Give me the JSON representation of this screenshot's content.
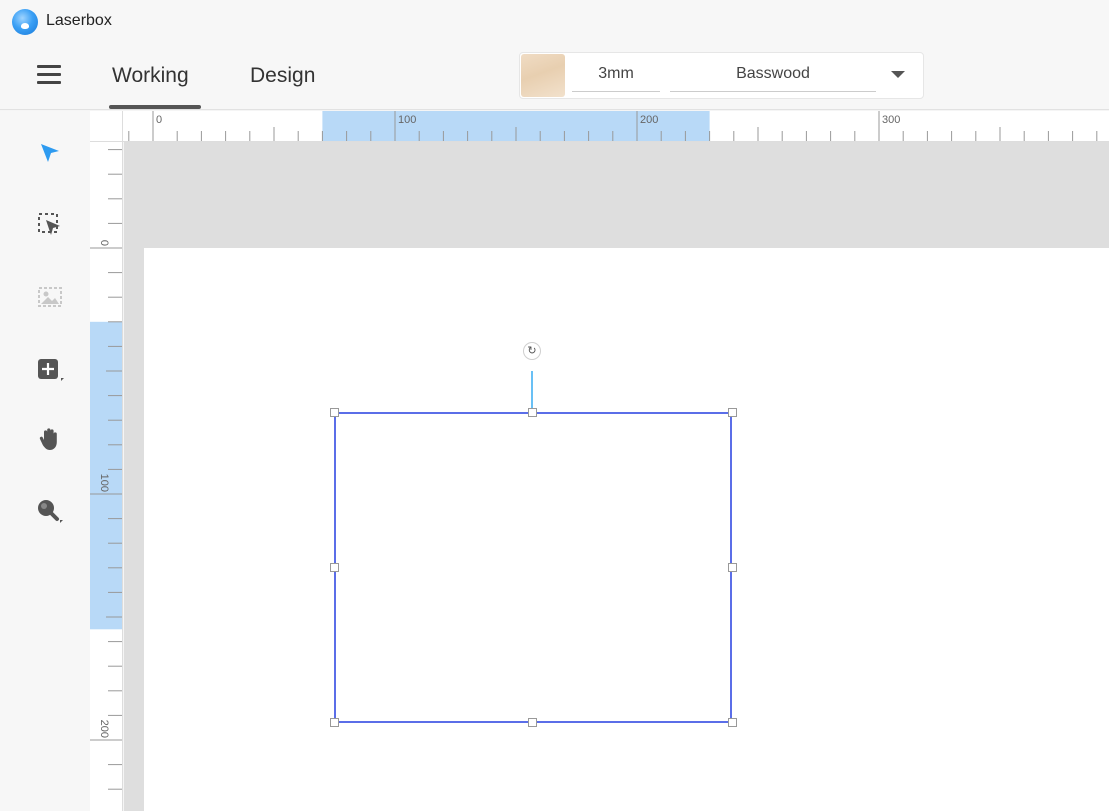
{
  "app": {
    "title": "Laserbox"
  },
  "toolbar": {
    "tabs": [
      {
        "label": "Working",
        "active": true
      },
      {
        "label": "Design",
        "active": false
      }
    ],
    "material": {
      "thickness": "3mm",
      "name": "Basswood"
    }
  },
  "sidebar": {
    "tools": [
      {
        "name": "select-tool",
        "icon": "arrow-pointer-icon",
        "active": true
      },
      {
        "name": "marquee-select-tool",
        "icon": "marquee-select-icon",
        "active": false
      },
      {
        "name": "image-tool",
        "icon": "image-icon",
        "active": false,
        "disabled": true
      },
      {
        "name": "add-shape-tool",
        "icon": "add-icon",
        "active": false
      },
      {
        "name": "pan-tool",
        "icon": "hand-icon",
        "active": false
      },
      {
        "name": "zoom-tool",
        "icon": "magnifier-icon",
        "active": false
      }
    ]
  },
  "rulers": {
    "horizontal": {
      "labels": [
        "0",
        "100",
        "200",
        "300"
      ],
      "highlight_range": [
        70,
        230
      ]
    },
    "vertical": {
      "labels": [
        "0",
        "100",
        "200"
      ],
      "highlight_range": [
        30,
        155
      ]
    }
  },
  "colors": {
    "accent": "#3ba0f5",
    "selection": "#5b6ee8",
    "ruler_highlight": "#b8d9f7",
    "canvas_bg": "#dedede"
  }
}
